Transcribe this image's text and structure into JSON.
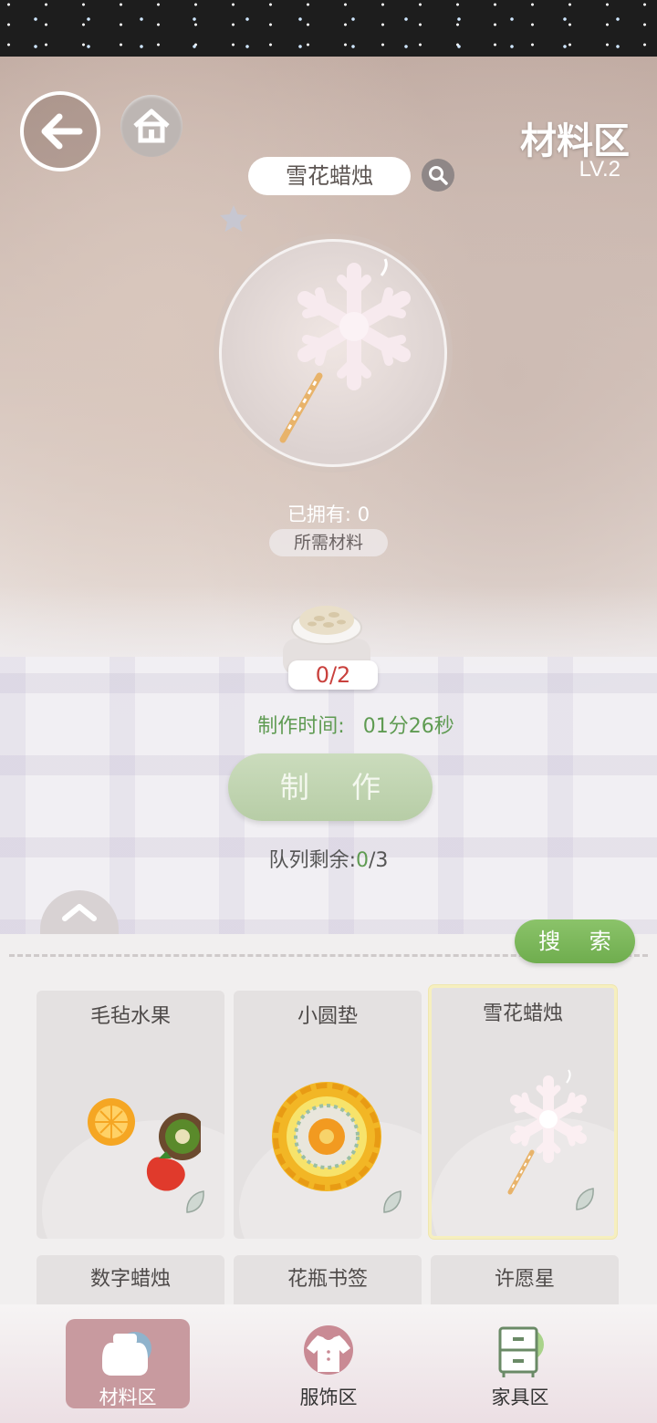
{
  "header": {
    "zone_title": "材料区",
    "zone_level": "LV.2"
  },
  "item": {
    "name": "雪花蜡烛",
    "owned": "已拥有: 0",
    "materials_label": "所需材料",
    "material_count": "0/2",
    "craft_time_label": "制作时间:",
    "craft_time_value": "01分26秒",
    "make_button": "制 作",
    "queue_label": "队列剩余:",
    "queue_used": "0",
    "queue_total": "/3"
  },
  "panel": {
    "search_button": "搜 索",
    "items": [
      {
        "label": "毛毡水果",
        "selected": false
      },
      {
        "label": "小圆垫",
        "selected": false
      },
      {
        "label": "雪花蜡烛",
        "selected": true
      },
      {
        "label": "数字蜡烛"
      },
      {
        "label": "花瓶书签"
      },
      {
        "label": "许愿星"
      }
    ]
  },
  "nav": {
    "tabs": [
      {
        "label": "材料区",
        "active": true
      },
      {
        "label": "服饰区",
        "active": false
      },
      {
        "label": "家具区",
        "active": false
      }
    ]
  },
  "colors": {
    "accent_green": "#6fad4e",
    "count_red": "#c9413d",
    "active_tab": "#c89a9f"
  }
}
